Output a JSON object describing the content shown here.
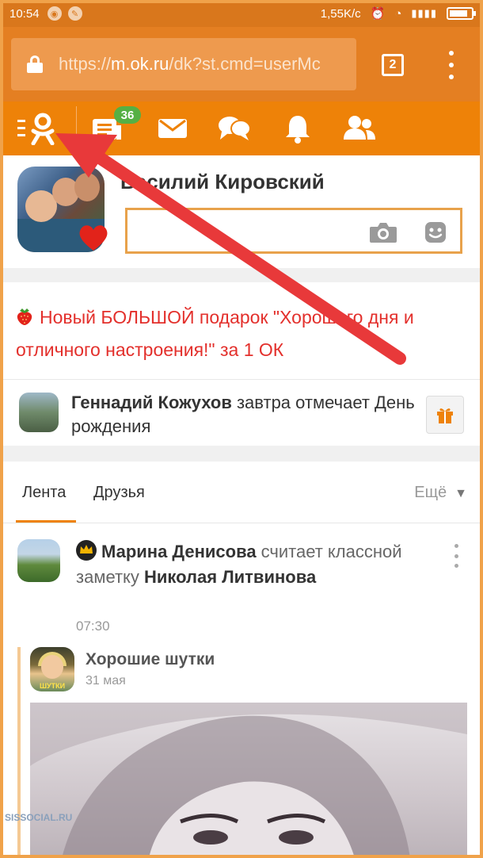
{
  "status_bar": {
    "time": "10:54",
    "network_speed": "1,55K/c"
  },
  "browser": {
    "url_prefix": "https://",
    "url_domain": "m.ok.ru",
    "url_path": "/dk?st.cmd=userMc",
    "tab_count": "2"
  },
  "nav": {
    "notifications_badge": "36",
    "icons": [
      "ok-menu-icon",
      "feed-icon",
      "messages-icon",
      "discussions-icon",
      "notifications-icon",
      "friends-icon"
    ]
  },
  "profile": {
    "name": "Василий Кировский",
    "status_placeholder": ""
  },
  "promo": {
    "text": "Новый БОЛЬШОЙ подарок \"Хорошего дня и отличного настроения!\" за 1 ОК"
  },
  "birthday": {
    "name": "Геннадий Кожухов",
    "text_after": " завтра отмечает День рождения"
  },
  "feed_tabs": {
    "tab1": "Лента",
    "tab2": "Друзья",
    "more": "Ещё"
  },
  "post": {
    "author": "Марина Денисова",
    "action": " считает классной заметку ",
    "target": "Николая Литвинова",
    "time": "07:30",
    "group_name": "Хорошие шутки",
    "group_date": "31 мая",
    "group_avatar_caption": "ШУТКИ"
  },
  "watermark": "SISSOCIAL.RU",
  "colors": {
    "accent": "#ee8208",
    "status_bar": "#d9771c",
    "browser_bar": "#e47f22",
    "promo_red": "#e3302c",
    "badge_green": "#55b044",
    "arrow_red": "#e8393a"
  }
}
